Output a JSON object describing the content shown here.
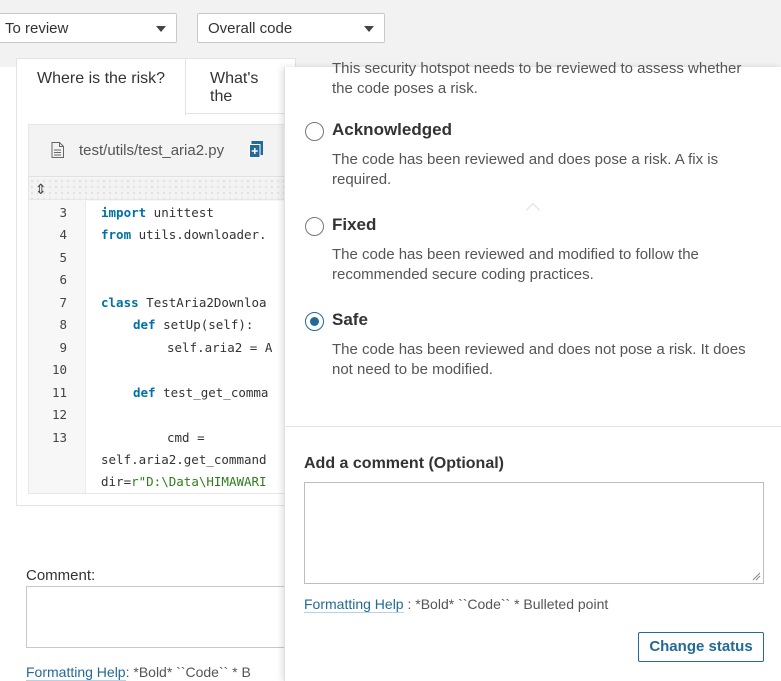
{
  "filters": {
    "status": "To review",
    "scope": "Overall code"
  },
  "tabs": [
    {
      "label": "Where is the risk?",
      "active": true
    },
    {
      "label": "What's the"
    }
  ],
  "file": {
    "path": "test/utils/test_aria2.py"
  },
  "code": {
    "lines": [
      {
        "num": "3",
        "kw": "import",
        "rest": " unittest"
      },
      {
        "num": "4",
        "kw": "from",
        "rest": " utils.downloader."
      },
      {
        "num": "5",
        "kw": "",
        "rest": ""
      },
      {
        "num": "6",
        "kw": "",
        "rest": ""
      },
      {
        "num": "7",
        "kw": "class",
        "rest": " TestAria2Downloa"
      },
      {
        "num": "8",
        "kw": "def",
        "rest": " setUp(self):"
      },
      {
        "num": "9",
        "kw": "",
        "rest": "self.aria2 = A"
      },
      {
        "num": "10",
        "kw": "",
        "rest": ""
      },
      {
        "num": "11",
        "kw": "def",
        "rest": " test_get_comma"
      },
      {
        "num": "12",
        "kw": "",
        "rest": ""
      },
      {
        "num": "13",
        "kw": "",
        "rest": "cmd ="
      }
    ],
    "wrap1": "self.aria2.get_command",
    "wrap2_prefix": "dir=",
    "wrap2_str": "r\"D:\\Data\\HIMAWARI"
  },
  "comment_section": {
    "label": "Comment:",
    "formatting_help": "Formatting Help",
    "hints": ":   *Bold*   ``Code``   * B"
  },
  "review": {
    "intro": "This security hotspot needs to be reviewed to assess whether the code poses a risk.",
    "options": [
      {
        "title": "Acknowledged",
        "desc": "The code has been reviewed and does pose a risk. A fix is required.",
        "checked": false
      },
      {
        "title": "Fixed",
        "desc": "The code has been reviewed and modified to follow the recommended secure coding practices.",
        "checked": false
      },
      {
        "title": "Safe",
        "desc": "The code has been reviewed and does not pose a risk. It does not need to be modified.",
        "checked": true
      }
    ],
    "add_comment_label": "Add a comment (Optional)",
    "comment_value": "",
    "formatting_help": "Formatting Help",
    "hints": " :   *Bold*   ``Code``   * Bulleted point",
    "submit_label": "Change status"
  },
  "colors": {
    "accent": "#236a97",
    "keyword": "#0071a6",
    "string": "#2e7d1b"
  }
}
